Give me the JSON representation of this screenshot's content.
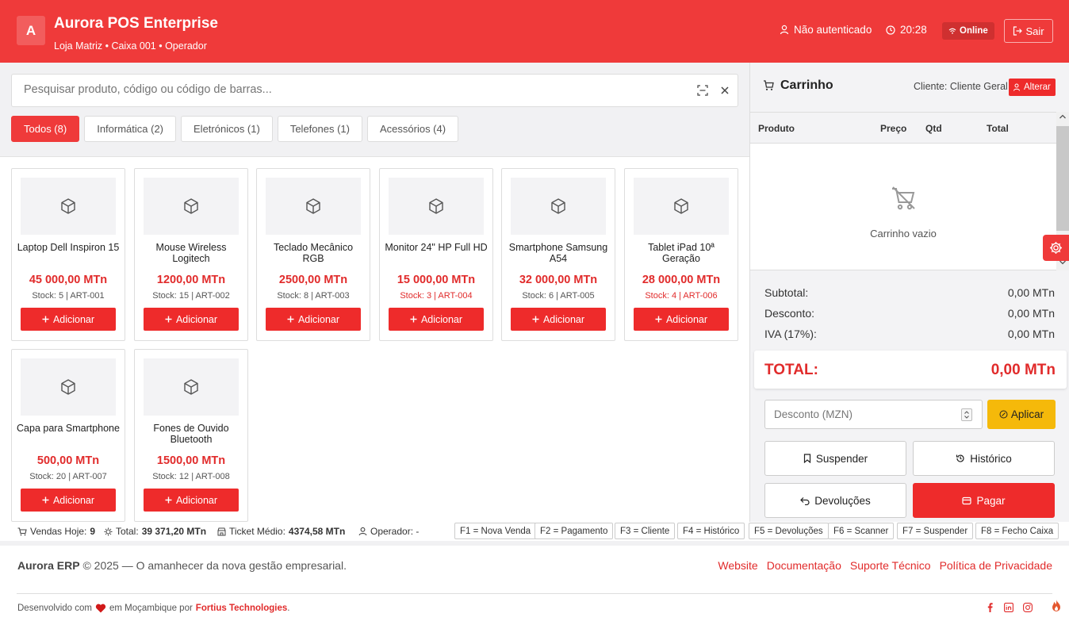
{
  "header": {
    "logo_letter": "A",
    "app_title": "Aurora POS Enterprise",
    "subtitle": "Loja Matriz • Caixa 001 • Operador",
    "auth_status": "Não autenticado",
    "time": "20:28",
    "online": "Online",
    "logout": "Sair"
  },
  "search": {
    "placeholder": "Pesquisar produto, código ou código de barras..."
  },
  "tabs": [
    "Todos (8)",
    "Informática (2)",
    "Eletrónicos (1)",
    "Telefones (1)",
    "Acessórios (4)"
  ],
  "add_label": "Adicionar",
  "products": [
    {
      "name": "Laptop Dell Inspiron 15",
      "price": "45 000,00 MTn",
      "stock": "Stock: 5 | ART-001"
    },
    {
      "name": "Mouse Wireless Logitech",
      "price": "1200,00 MTn",
      "stock": "Stock: 15 | ART-002"
    },
    {
      "name": "Teclado Mecânico RGB",
      "price": "2500,00 MTn",
      "stock": "Stock: 8 | ART-003"
    },
    {
      "name": "Monitor 24\" HP Full HD",
      "price": "15 000,00 MTn",
      "stock": "Stock: 3 | ART-004"
    },
    {
      "name": "Smartphone Samsung A54",
      "price": "32 000,00 MTn",
      "stock": "Stock: 6 | ART-005"
    },
    {
      "name": "Tablet iPad 10ª Geração",
      "price": "28 000,00 MTn",
      "stock": "Stock: 4 | ART-006"
    },
    {
      "name": "Capa para Smartphone",
      "price": "500,00 MTn",
      "stock": "Stock: 20 | ART-007"
    },
    {
      "name": "Fones de Ouvido Bluetooth",
      "price": "1500,00 MTn",
      "stock": "Stock: 12 | ART-008"
    }
  ],
  "status": {
    "sales_label": "Vendas Hoje:",
    "sales_value": "9",
    "total_label": "Total:",
    "total_value": "39 371,20 MTn",
    "ticket_label": "Ticket Médio:",
    "ticket_value": "4374,58 MTn",
    "operator_label": "Operador: -"
  },
  "shortcuts": [
    "F1 = Nova Venda",
    "F2 = Pagamento",
    "F3 = Cliente",
    "F4 = Histórico",
    "F5 = Devoluções",
    "F6 = Scanner",
    "F7 = Suspender",
    "F8 = Fecho Caixa"
  ],
  "cart": {
    "title": "Carrinho",
    "client": "Cliente: Cliente Geral",
    "change_client": "Alterar",
    "columns": [
      "Produto",
      "Preço",
      "Qtd",
      "Total"
    ],
    "empty": "Carrinho vazio",
    "subtotal_label": "Subtotal:",
    "subtotal": "0,00 MTn",
    "discount_label": "Desconto:",
    "discount": "0,00 MTn",
    "iva_label": "IVA (17%):",
    "iva": "0,00 MTn",
    "total_label": "TOTAL:",
    "total": "0,00 MTn",
    "discount_placeholder": "Desconto (MZN)",
    "apply": "Aplicar",
    "suspend": "Suspender",
    "history": "Histórico",
    "returns": "Devoluções",
    "pay": "Pagar"
  },
  "footer": {
    "brand": "Aurora ERP",
    "copyright": "© 2025 — O amanhecer da nova gestão empresarial.",
    "links": [
      "Website",
      "Documentação",
      "Suporte Técnico",
      "Política de Privacidade"
    ],
    "dev_prefix": "Desenvolvido com",
    "dev_middle": "em Moçambique por",
    "dev_company": "Fortius Technologies",
    "dev_suffix": "."
  },
  "colors": {
    "primary": "#ef3a3a",
    "accent_yellow": "#f5b90a"
  }
}
